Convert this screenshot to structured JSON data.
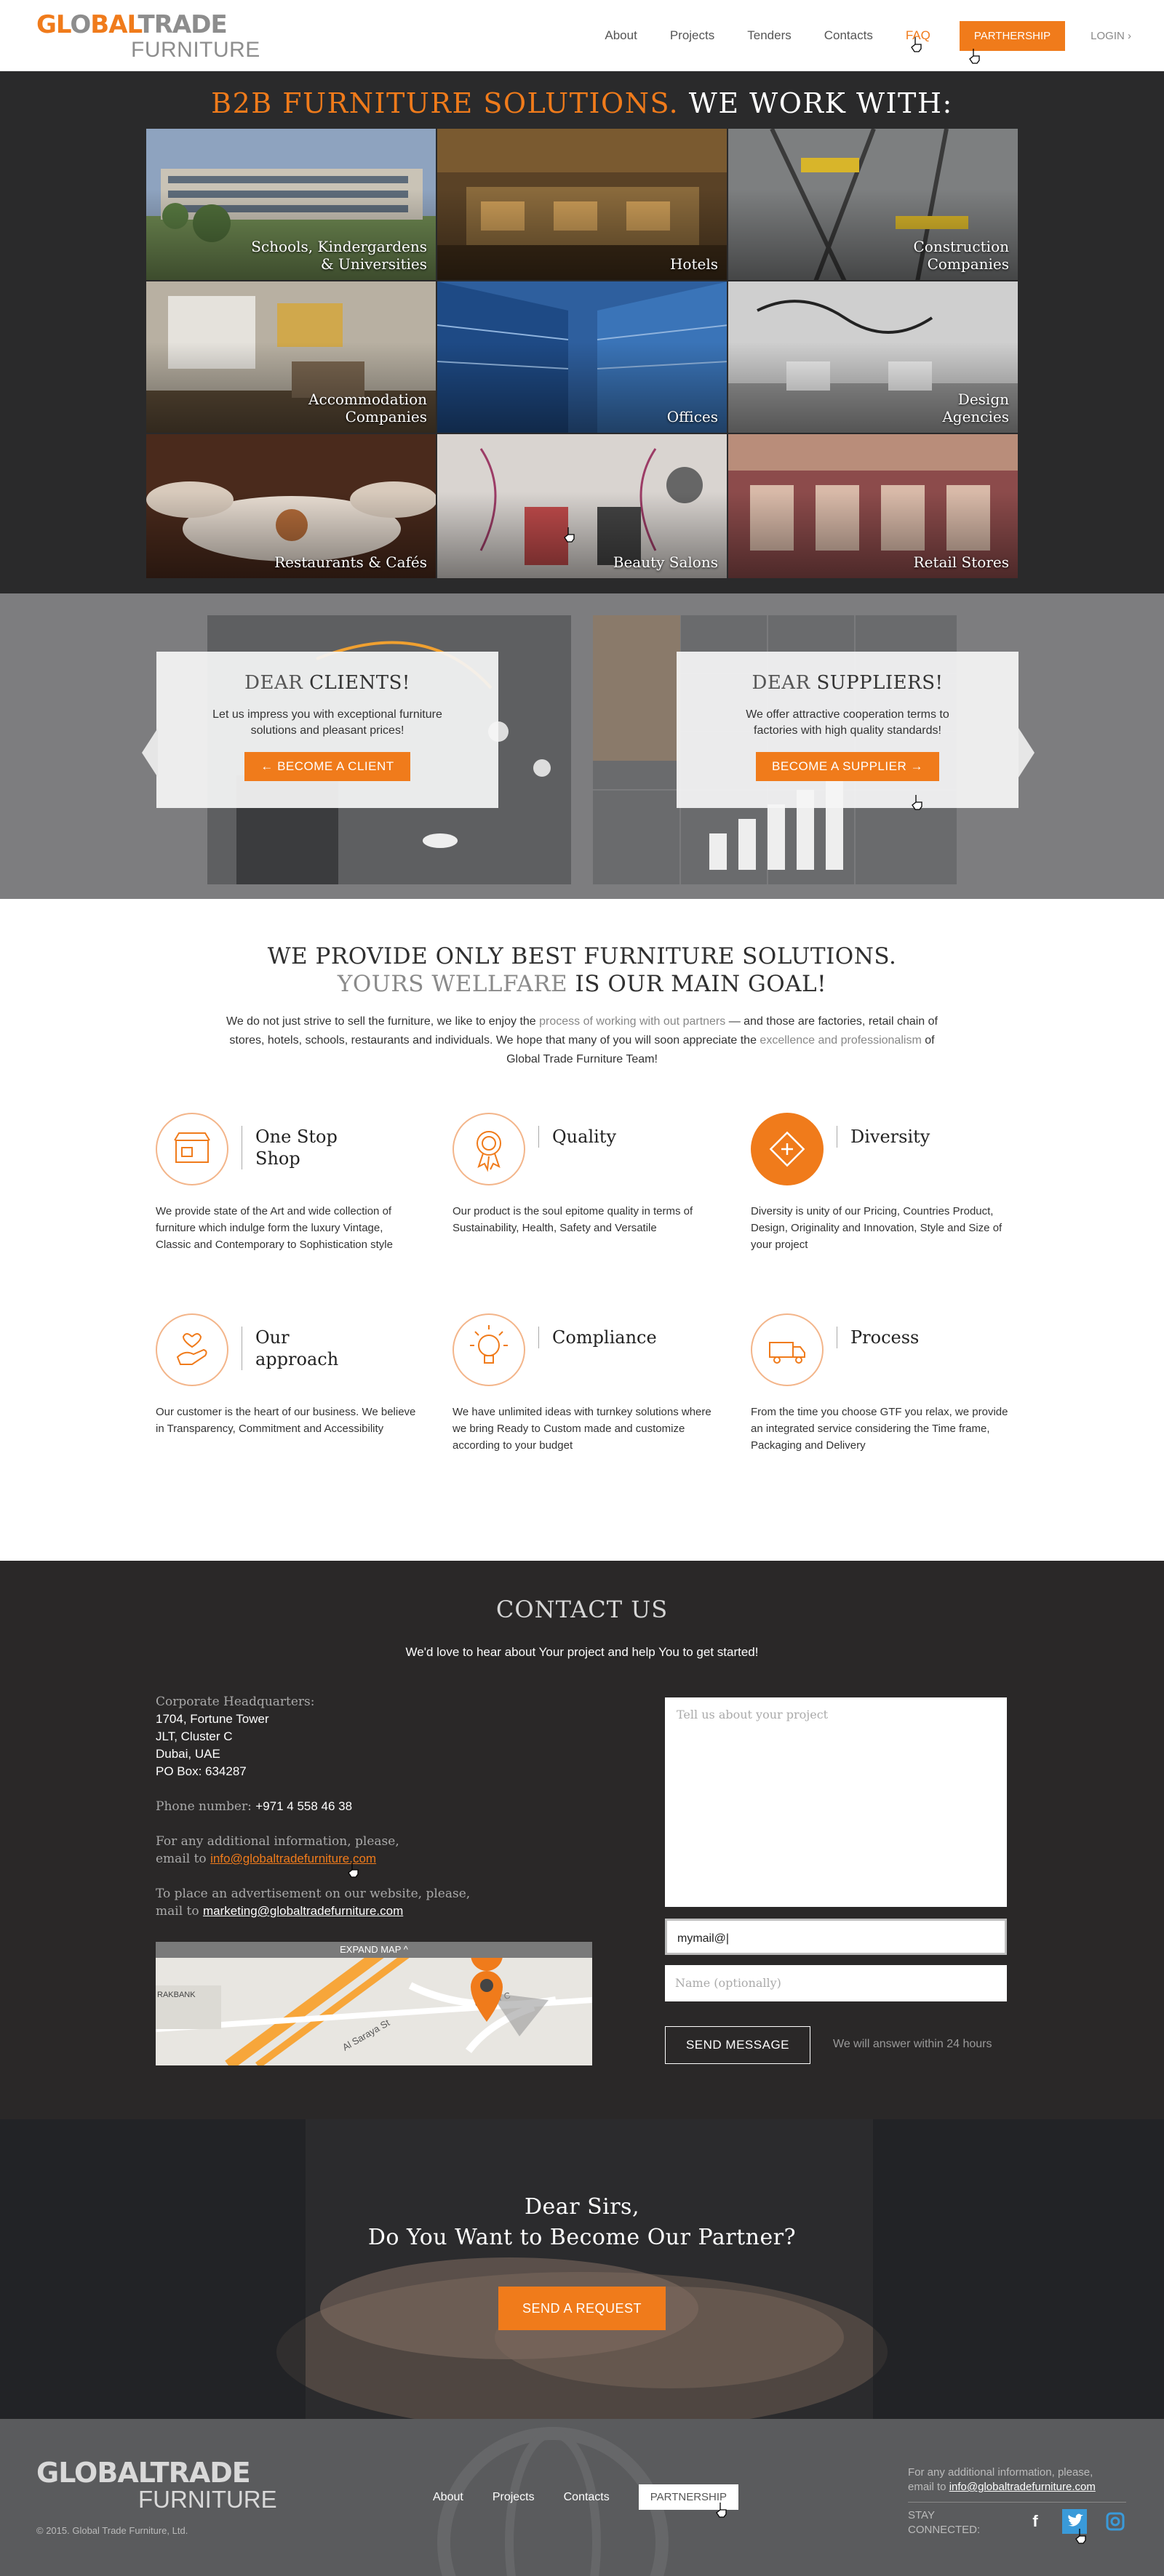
{
  "header": {
    "logo": {
      "part1_orange": "GL",
      "part1_grey_o": "O",
      "part1_orange2": "BAL",
      "part1_grey": "TRADE",
      "part2": "FURNITURE"
    },
    "nav": [
      "About",
      "Projects",
      "Tenders",
      "Contacts",
      "FAQ"
    ],
    "partnership_button": "PARTHERSHIP",
    "login": "LOGIN ›"
  },
  "hero": {
    "title_orange": "B2B FURNITURE SOLUTIONS.",
    "title_white": " WE WORK WITH:",
    "tiles": [
      {
        "label_1": "Schools, Kindergardens",
        "label_2": "& Universities"
      },
      {
        "label_1": "Hotels",
        "label_2": ""
      },
      {
        "label_1": "Construction",
        "label_2": "Companies"
      },
      {
        "label_1": "Accommodation",
        "label_2": "Companies"
      },
      {
        "label_1": "Offices",
        "label_2": ""
      },
      {
        "label_1": "Design",
        "label_2": "Agencies"
      },
      {
        "label_1": "Restaurants & Cafés",
        "label_2": ""
      },
      {
        "label_1": "Beauty Salons",
        "label_2": ""
      },
      {
        "label_1": "Retail Stores",
        "label_2": ""
      }
    ]
  },
  "dear": {
    "clients": {
      "title_light": "DEAR ",
      "title_bold": "CLIENTS!",
      "text": "Let us impress you with exceptional furniture solutions and pleasant prices!",
      "button": "← BECOME A CLIENT"
    },
    "suppliers": {
      "title_light": "DEAR ",
      "title_bold": "SUPPLIERS!",
      "text": "We offer attractive cooperation terms to factories with high quality standards!",
      "button": "BECOME A SUPPLIER →"
    }
  },
  "solutions": {
    "title_line1": "WE PROVIDE ONLY BEST FURNITURE SOLUTIONS.",
    "title_line2_grey": "YOURS WELLFARE",
    "title_line2_dark": " IS OUR MAIN GOAL!",
    "intro_a": "We do not just strive to sell the furniture, we like to enjoy the ",
    "intro_b": "process of working with out partners",
    "intro_c": " — and those are factories, retail chain of stores, hotels, schools, restaurants and individuals. We hope that many of you will soon appreciate the ",
    "intro_d": "excellence and professionalism",
    "intro_e": " of Global Trade Furniture Team!",
    "features": [
      {
        "title": "One Stop Shop",
        "desc": "We provide state of the Art and wide collection of furniture which indulge form the luxury Vintage, Classic and Contemporary to Sophistication style"
      },
      {
        "title": "Quality",
        "desc": "Our product is the soul epitome quality in terms of Sustainability, Health, Safety and Versatile"
      },
      {
        "title": "Diversity",
        "desc": "Diversity is unity of our Pricing, Countries Product, Design, Originality and Innovation, Style and Size of your project"
      },
      {
        "title": "Our approach",
        "desc": "Our customer is the heart of our business. We believe in Transparency, Commitment and Accessibility"
      },
      {
        "title": "Compliance",
        "desc": "We have unlimited ideas with turnkey solutions where we bring Ready to Custom made and customize according to your budget"
      },
      {
        "title": "Process",
        "desc": "From the time you choose GTF you relax, we provide an integrated service considering the Time frame, Packaging and Delivery"
      }
    ]
  },
  "contact": {
    "title": "CONTACT US",
    "subtitle": "We'd love to hear about Your project and help You to get started!",
    "hq_label": "Corporate Headquarters:",
    "address": [
      "1704, Fortune Tower",
      "JLT, Cluster C",
      "Dubai, UAE",
      "PO Box: 634287"
    ],
    "phone_label": "Phone number: ",
    "phone": "+971 4 558 46 38",
    "info_text_1": "For any additional information, please,",
    "info_text_2": "email to ",
    "info_email": "info@globaltradefurniture.com",
    "ad_text_1": "To place an advertisement on our website, please,",
    "ad_text_2": "mail to ",
    "ad_email": "marketing@globaltradefurniture.com",
    "map_expand": "EXPAND MAP ^",
    "map_labels": [
      "RAKBANK",
      "Al Saraya St",
      "Cluster C"
    ],
    "project_placeholder": "Tell us about your project",
    "email_value": "mymail@|",
    "name_placeholder": "Name (optionally)",
    "send_button": "SEND MESSAGE",
    "reply_note": "We will answer within 24 hours"
  },
  "partner": {
    "line1": "Dear Sirs,",
    "line2": "Do You Want to Become Our Partner?",
    "button": "SEND A REQUEST"
  },
  "footer": {
    "logo_a": "GLOBALTRADE",
    "logo_b": "FURNITURE",
    "copyright": "© 2015. Global Trade Furniture, Ltd.",
    "nav": [
      "About",
      "Projects",
      "Contacts"
    ],
    "partnership_button": "PARTNERSHIP",
    "info_1": "For any additional information, please,",
    "info_2": "email to ",
    "info_email": "info@globaltradefurniture.com",
    "stay_1": "STAY",
    "stay_2": "CONNECTED:",
    "social": [
      "facebook-icon",
      "twitter-icon",
      "instagram-icon"
    ]
  },
  "colors": {
    "accent": "#f07b1b",
    "dark": "#2a2a2b",
    "grey_band": "#7d7d7f",
    "footer": "#5a5b5d"
  }
}
